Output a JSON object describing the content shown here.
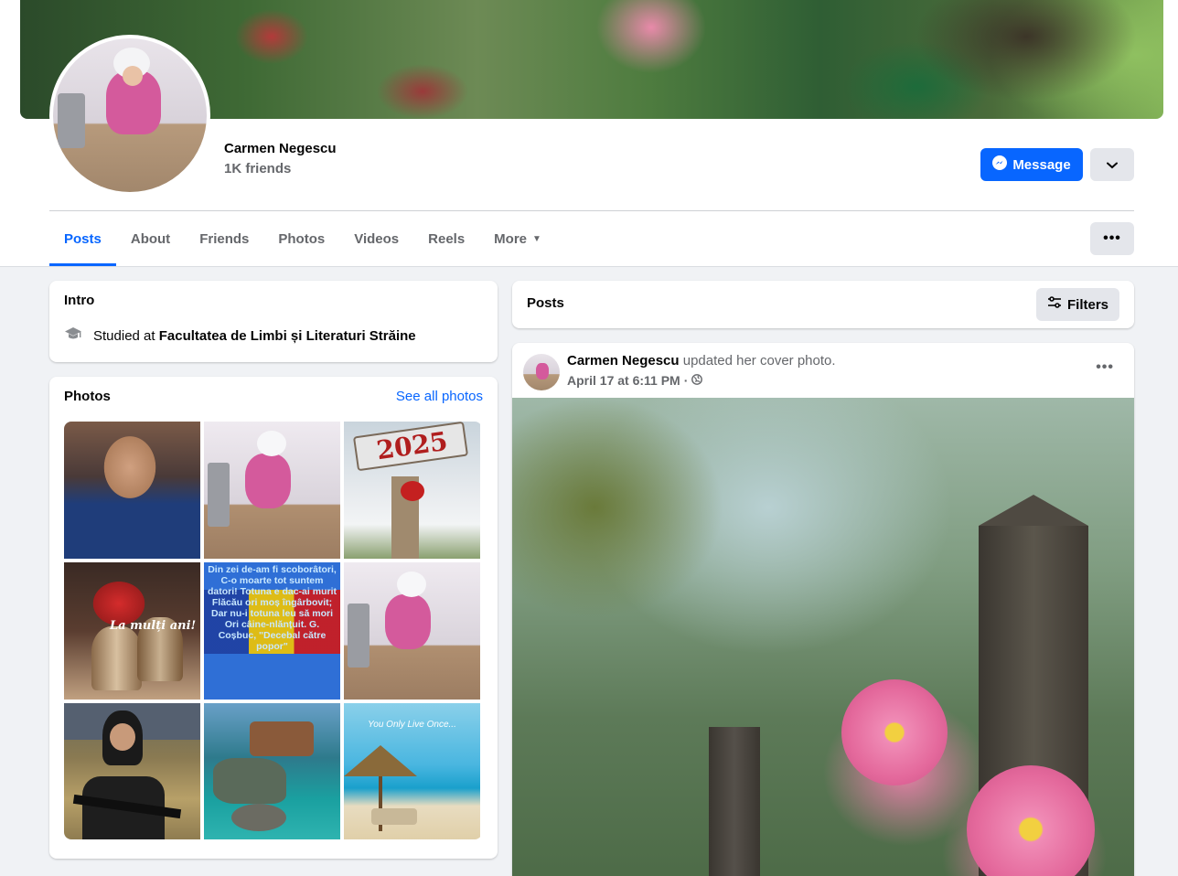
{
  "profile": {
    "name": "Carmen Negescu",
    "friends": "1K friends"
  },
  "actions": {
    "message_label": "Message"
  },
  "tabs": [
    {
      "label": "Posts",
      "active": true
    },
    {
      "label": "About"
    },
    {
      "label": "Friends"
    },
    {
      "label": "Photos"
    },
    {
      "label": "Videos"
    },
    {
      "label": "Reels"
    },
    {
      "label": "More"
    }
  ],
  "intro": {
    "title": "Intro",
    "studied_prefix": "Studied at",
    "school": "Facultatea de Limbi și Literaturi Străine"
  },
  "photos": {
    "title": "Photos",
    "see_all": "See all photos",
    "items": [
      {
        "label": ""
      },
      {
        "label": ""
      },
      {
        "label": "2025"
      },
      {
        "label": "La mulți ani!"
      },
      {
        "label": "Din zei de-am fi scoborâtori, C-o moarte tot suntem datori! Totuna e dac-ai murit Flăcău ori moș îngârbovit; Dar nu-i totuna leu să mori Ori câine-nlănțuit. G. Coșbuc, \"Decebal către popor\""
      },
      {
        "label": ""
      },
      {
        "label": ""
      },
      {
        "label": ""
      },
      {
        "label": "You Only Live Once..."
      }
    ]
  },
  "posts_header": {
    "title": "Posts",
    "filters_label": "Filters"
  },
  "post": {
    "author": "Carmen Negescu",
    "action": "updated her cover photo.",
    "time": "April 17 at 6:11 PM",
    "separator": "·"
  },
  "colors": {
    "accent": "#0866ff",
    "secondary_button": "#e4e6eb",
    "page_bg": "#f0f2f5"
  },
  "icons": {
    "messenger": "messenger-icon",
    "chevron": "chevron-down-icon",
    "education": "graduation-cap-icon",
    "filters": "sliders-icon",
    "globe": "globe-icon",
    "more": "more-dots-icon"
  }
}
